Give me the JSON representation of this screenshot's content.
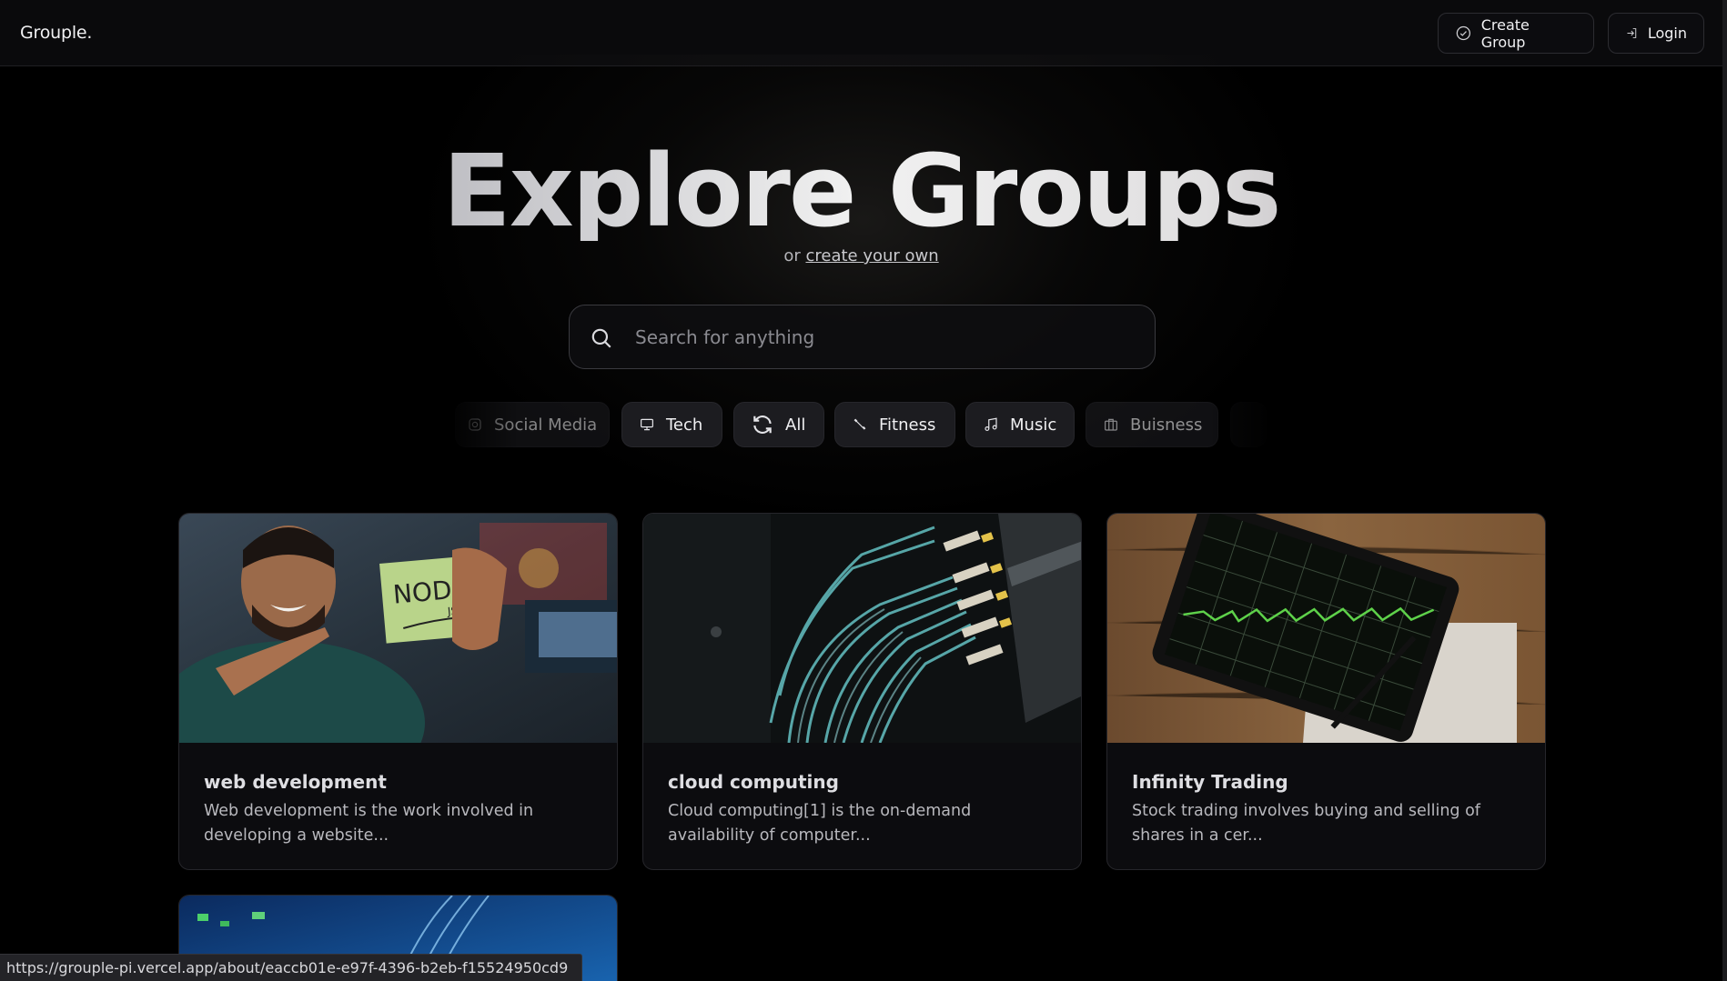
{
  "header": {
    "brand": "Grouple.",
    "create_group_label": "Create Group",
    "login_label": "Login"
  },
  "hero": {
    "title": "Explore Groups",
    "subtitle_prefix": "or",
    "subtitle_link": "create your own"
  },
  "search": {
    "placeholder": "Search for anything",
    "value": ""
  },
  "categories": [
    {
      "label": "Social Media",
      "icon": "instagram-icon"
    },
    {
      "label": "Tech",
      "icon": "monitor-icon"
    },
    {
      "label": "All",
      "icon": "refresh-icon"
    },
    {
      "label": "Fitness",
      "icon": "dumbbell-icon"
    },
    {
      "label": "Music",
      "icon": "music-note-icon"
    },
    {
      "label": "Buisness",
      "icon": "briefcase-icon"
    }
  ],
  "groups": [
    {
      "title": "web development",
      "description": "Web development is the work involved in developing a website..."
    },
    {
      "title": "cloud computing",
      "description": "Cloud computing[1] is the on-demand availability of computer..."
    },
    {
      "title": "Infinity Trading",
      "description": "Stock trading involves buying and selling of shares in a cer..."
    }
  ],
  "status_bar": {
    "url": "https://grouple-pi.vercel.app/about/eaccb01e-e97f-4396-b2eb-f15524950cd9"
  }
}
